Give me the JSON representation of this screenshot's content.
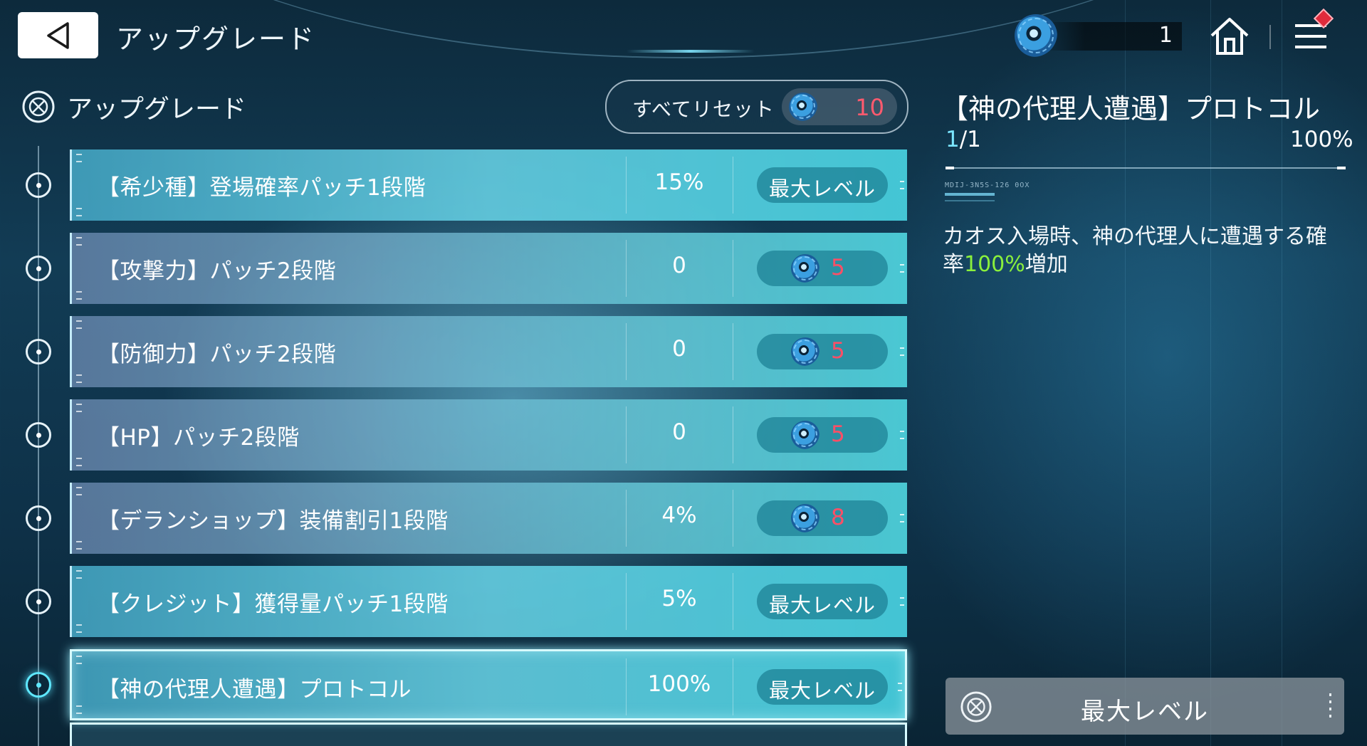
{
  "header": {
    "title": "アップグレード",
    "currency_count": "1"
  },
  "panel": {
    "section_label": "アップグレード",
    "reset_label": "すべてリセット",
    "reset_cost": "10"
  },
  "upgrades": [
    {
      "name": "【希少種】登場確率パッチ1段階",
      "value": "15%",
      "action": "最大レベル",
      "cost": null,
      "maxed": true
    },
    {
      "name": "【攻撃力】パッチ2段階",
      "value": "0",
      "action": null,
      "cost": "5",
      "maxed": false
    },
    {
      "name": "【防御力】パッチ2段階",
      "value": "0",
      "action": null,
      "cost": "5",
      "maxed": false
    },
    {
      "name": "【HP】パッチ2段階",
      "value": "0",
      "action": null,
      "cost": "5",
      "maxed": false
    },
    {
      "name": "【デランショップ】装備割引1段階",
      "value": "4%",
      "action": null,
      "cost": "8",
      "maxed": false
    },
    {
      "name": "【クレジット】獲得量パッチ1段階",
      "value": "5%",
      "action": "最大レベル",
      "cost": null,
      "maxed": true
    },
    {
      "name": "【神の代理人遭遇】プロトコル",
      "value": "100%",
      "action": "最大レベル",
      "cost": null,
      "maxed": true,
      "selected": true
    }
  ],
  "detail": {
    "title": "【神の代理人遭遇】プロトコル",
    "level_current": "1",
    "level_total": "/1",
    "percent": "100%",
    "code": "MDIJ-3N5S-126 0OX",
    "description_pre": "カオス入場時、神の代理人に遭遇する確率",
    "description_highlight": "100%",
    "description_post": "増加",
    "button_label": "最大レベル"
  },
  "colors": {
    "cost_red": "#ff4f66",
    "highlight_green": "#8af03c",
    "level_cyan": "#7be6ff"
  },
  "icons": {
    "back": "back-triangle-icon",
    "currency": "blue-flower-coin-icon",
    "home": "home-icon",
    "menu": "hamburger-menu-icon",
    "section": "target-reticle-icon"
  }
}
